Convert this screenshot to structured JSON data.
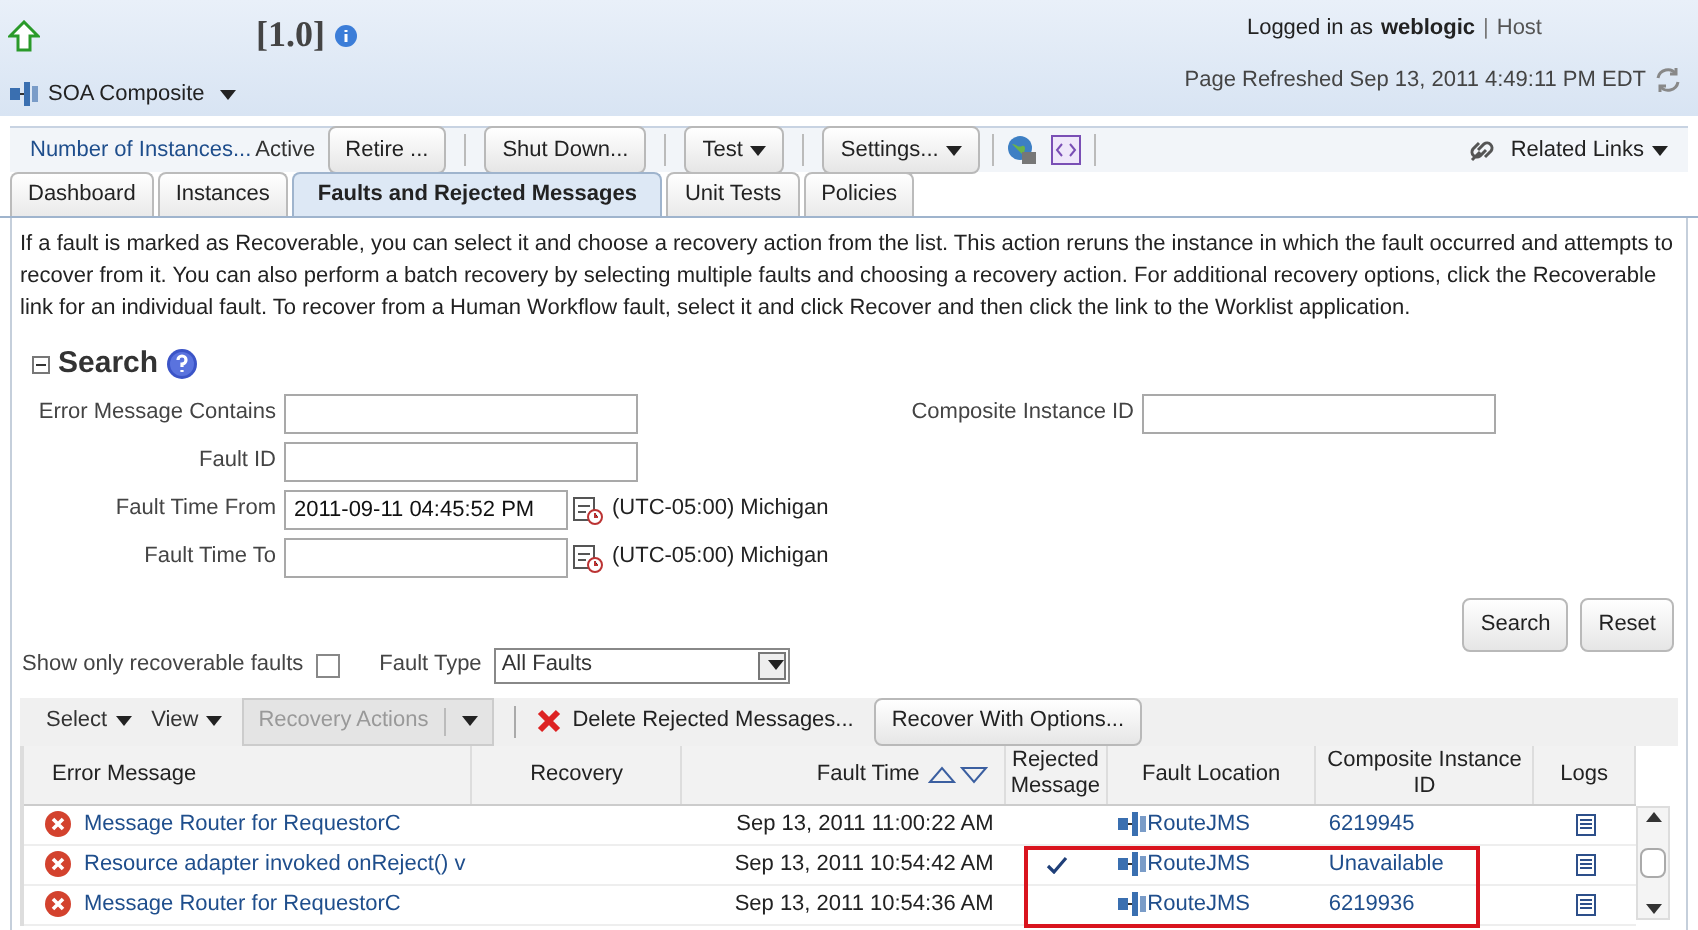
{
  "header": {
    "version": "[1.0]",
    "composite_menu": "SOA Composite",
    "logged_in_label": "Logged in as",
    "user": "weblogic",
    "separator": "|",
    "host": "Host",
    "refreshed": "Page Refreshed Sep 13, 2011 4:49:11 PM EDT"
  },
  "toolbar": {
    "instances_link": "Number of Instances...",
    "status": "Active",
    "buttons": [
      {
        "label": "Retire ...",
        "menu": false
      },
      {
        "label": "Shut Down...",
        "menu": false
      },
      {
        "label": "Test",
        "menu": true
      },
      {
        "label": "Settings...",
        "menu": true
      }
    ],
    "related_links": "Related Links"
  },
  "tabs": [
    {
      "label": "Dashboard",
      "selected": false
    },
    {
      "label": "Instances",
      "selected": false
    },
    {
      "label": "Faults and Rejected Messages",
      "selected": true
    },
    {
      "label": "Unit Tests",
      "selected": false
    },
    {
      "label": "Policies",
      "selected": false
    }
  ],
  "description": "If a fault is marked as Recoverable, you can select it and choose a recovery action from the list. This action reruns the instance in which the fault occurred and attempts to recover from it. You can also perform a batch recovery by selecting multiple faults and choosing a recovery action. For additional recovery options, click the Recoverable link for an individual fault. To recover from a Human Workflow fault, select it and click Recover and then click the link to the Worklist application.",
  "search": {
    "title": "Search",
    "expanded": true,
    "fields": [
      {
        "label": "Error Message Contains"
      },
      {
        "label": "Fault ID"
      },
      {
        "label": "Fault Time From",
        "value": "2011-09-11 04:45:52 PM",
        "timezone": "(UTC-05:00) Michigan"
      },
      {
        "label": "Fault Time To",
        "timezone": "(UTC-05:00) Michigan"
      }
    ],
    "instance_id_label": "Composite Instance ID",
    "buttons": [
      "Search",
      "Reset"
    ],
    "recoverable_label": "Show only recoverable faults",
    "recoverable_checked": false,
    "fault_type_label": "Fault Type",
    "fault_type": "All Faults"
  },
  "table_toolbar": {
    "select": "Select",
    "view": "View",
    "recovery_actions": "Recovery Actions",
    "recovery_disabled": true,
    "delete": "Delete Rejected Messages...",
    "recover": "Recover With Options..."
  },
  "table": {
    "columns": [
      "Error Message",
      "Recovery",
      "Fault Time",
      "Rejected Message",
      "Fault Location",
      "Composite Instance ID",
      "Logs"
    ],
    "rows": [
      {
        "error": "Message Router for RequestorC",
        "fault_time": "Sep 13, 2011 11:00:22 AM",
        "rejected": false,
        "location": "RouteJMS",
        "instance_id": "6219945"
      },
      {
        "error": "Resource adapter invoked onReject() v",
        "fault_time": "Sep 13, 2011 10:54:42 AM",
        "rejected": true,
        "location": "RouteJMS",
        "instance_id": "Unavailable"
      },
      {
        "error": "Message Router for RequestorC",
        "fault_time": "Sep 13, 2011 10:54:36 AM",
        "rejected": false,
        "location": "RouteJMS",
        "instance_id": "6219936"
      }
    ]
  }
}
